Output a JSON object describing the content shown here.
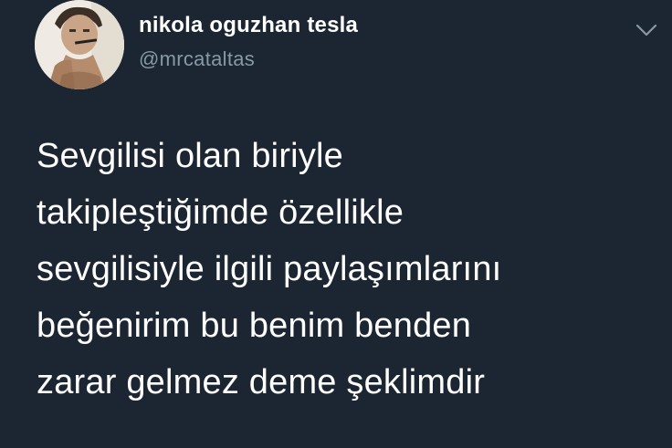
{
  "tweet": {
    "author": {
      "display_name": "nikola oguzhan tesla",
      "handle": "@mrcataltas",
      "avatar_icon": "profile-photo"
    },
    "menu_icon": "chevron-down-icon",
    "text_lines": [
      "Sevgilisi olan biriyle",
      "takipleştiğimde özellikle",
      "sevgilisiyle ilgili paylaşımlarını",
      "beğenirim bu benim benden",
      "zarar gelmez deme şeklimdir"
    ]
  },
  "colors": {
    "background": "#1c2532",
    "text_primary": "#ffffff",
    "text_secondary": "#8899a6"
  }
}
